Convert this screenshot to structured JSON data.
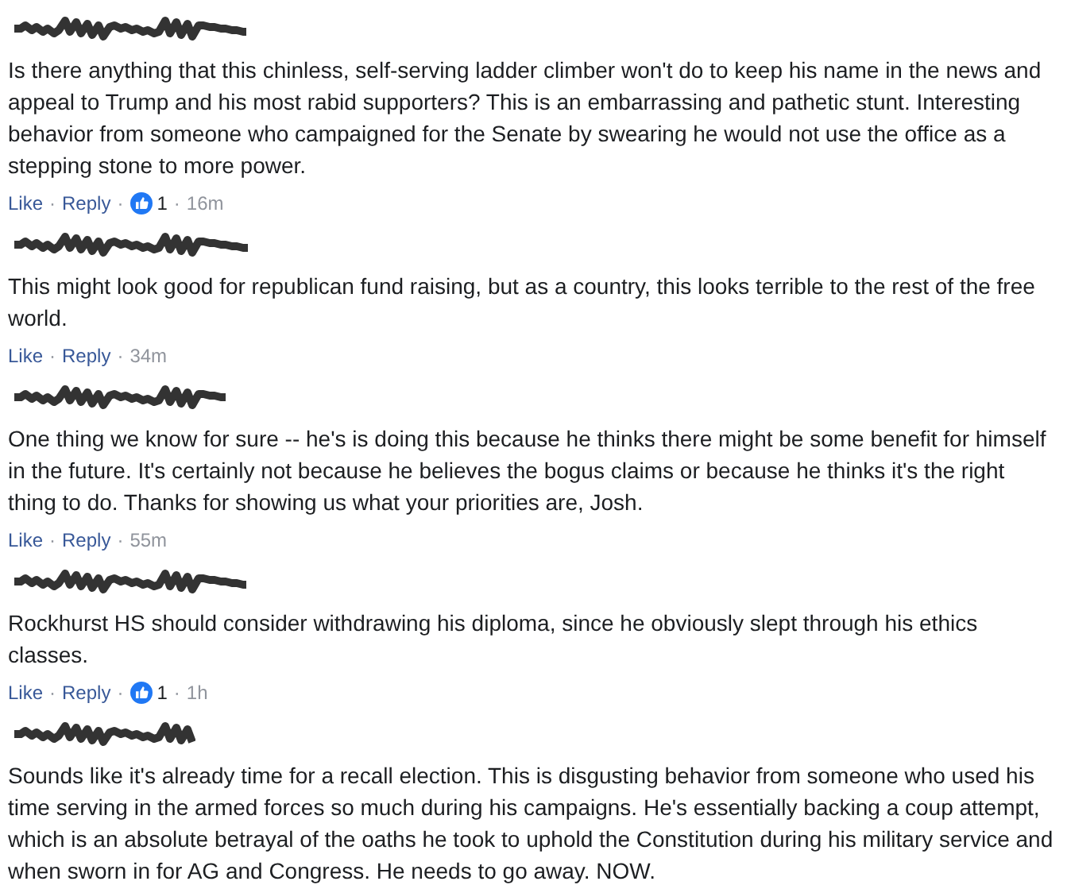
{
  "comments": [
    {
      "text": "Is there anything that this chinless, self-serving ladder climber won't do to keep his name in the news and appeal to Trump and his most rabid supporters? This is an embarrassing and pathetic stunt. Interesting behavior from someone who campaigned for the Senate by swearing he would not use the office as a stepping stone to more power.",
      "actions": [
        {
          "kind": "link",
          "text": "Like"
        },
        {
          "kind": "sep",
          "text": "·"
        },
        {
          "kind": "link",
          "text": "Reply"
        },
        {
          "kind": "sep",
          "text": "·"
        },
        {
          "kind": "likes",
          "text": "1"
        },
        {
          "kind": "sep",
          "text": "·"
        },
        {
          "kind": "time",
          "text": "16m"
        }
      ]
    },
    {
      "text": "This might look good for republican fund raising, but as a country, this looks terrible to the rest of the free world.",
      "actions": [
        {
          "kind": "link",
          "text": "Like"
        },
        {
          "kind": "sep",
          "text": "·"
        },
        {
          "kind": "link",
          "text": "Reply"
        },
        {
          "kind": "sep",
          "text": "·"
        },
        {
          "kind": "time",
          "text": "34m"
        }
      ]
    },
    {
      "text": "One thing we know for sure -- he's is doing this because he thinks there might be some benefit for himself in the future. It's certainly not because he believes the bogus claims or because he thinks it's the right thing to do. Thanks for showing us what your priorities are, Josh.",
      "actions": [
        {
          "kind": "link",
          "text": "Like"
        },
        {
          "kind": "sep",
          "text": "·"
        },
        {
          "kind": "link",
          "text": "Reply"
        },
        {
          "kind": "sep",
          "text": "·"
        },
        {
          "kind": "time",
          "text": "55m"
        }
      ]
    },
    {
      "text": "Rockhurst HS should consider withdrawing his diploma, since he obviously slept through his ethics classes.",
      "actions": [
        {
          "kind": "link",
          "text": "Like"
        },
        {
          "kind": "sep",
          "text": "·"
        },
        {
          "kind": "link",
          "text": "Reply"
        },
        {
          "kind": "sep",
          "text": "·"
        },
        {
          "kind": "likes",
          "text": "1"
        },
        {
          "kind": "sep",
          "text": "·"
        },
        {
          "kind": "time",
          "text": "1h"
        }
      ]
    },
    {
      "text": "Sounds like it's already time for a recall election. This is disgusting behavior from someone who used his time serving in the armed forces so much during his campaigns. He's essentially backing a coup attempt, which is an absolute betrayal of the oaths he took to uphold the Constitution during his military service and when sworn in for AG and Congress. He needs to go away. NOW."
    }
  ]
}
